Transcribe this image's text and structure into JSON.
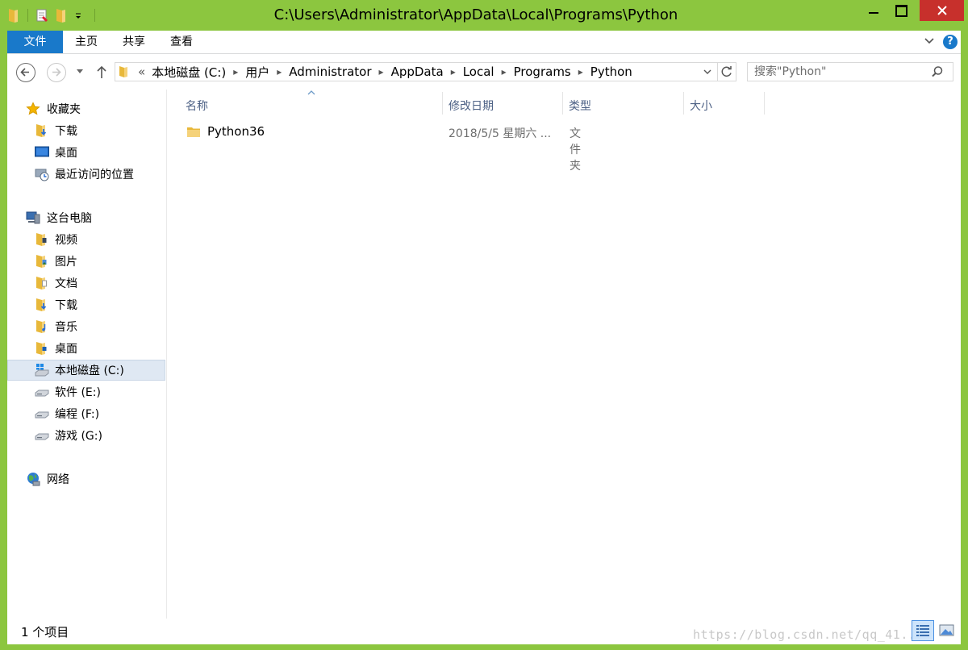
{
  "window": {
    "title": "C:\\Users\\Administrator\\AppData\\Local\\Programs\\Python",
    "accent": "#8cc63f",
    "close_color": "#c7302c"
  },
  "ribbon": {
    "file_tab": "文件",
    "tabs": [
      "主页",
      "共享",
      "查看"
    ],
    "help": "?"
  },
  "nav": {
    "breadcrumb_prefix": "«",
    "breadcrumbs": [
      "本地磁盘 (C:)",
      "用户",
      "Administrator",
      "AppData",
      "Local",
      "Programs",
      "Python"
    ],
    "search_placeholder": "搜索\"Python\""
  },
  "sidebar": {
    "favorites": {
      "label": "收藏夹",
      "items": [
        "下载",
        "桌面",
        "最近访问的位置"
      ]
    },
    "this_pc": {
      "label": "这台电脑",
      "items": [
        "视频",
        "图片",
        "文档",
        "下载",
        "音乐",
        "桌面",
        "本地磁盘 (C:)",
        "软件 (E:)",
        "编程 (F:)",
        "游戏 (G:)"
      ]
    },
    "network": {
      "label": "网络"
    }
  },
  "list": {
    "columns": [
      "名称",
      "修改日期",
      "类型",
      "大小"
    ],
    "rows": [
      {
        "name": "Python36",
        "date": "2018/5/5 星期六 ...",
        "type": "文件夹",
        "size": ""
      }
    ]
  },
  "status": {
    "count": "1 个项目",
    "watermark": "https://blog.csdn.net/qq_41...8"
  }
}
